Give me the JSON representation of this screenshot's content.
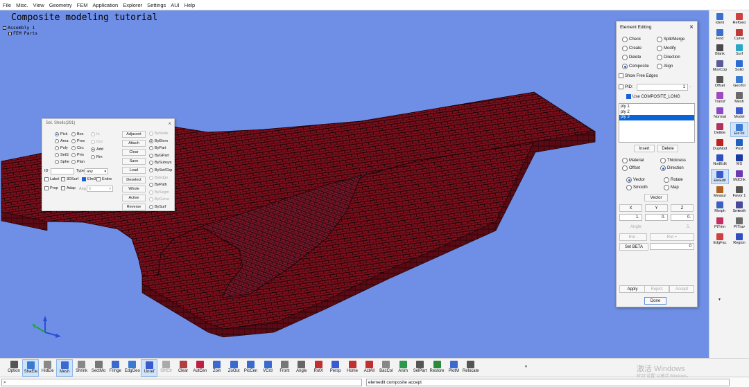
{
  "menu": [
    "File",
    "Misc.",
    "View",
    "Geometry",
    "FEM",
    "Application",
    "Explorer",
    "Settings",
    "AUI",
    "Help"
  ],
  "viewport": {
    "title": "Composite modeling tutorial",
    "tree": [
      "Assembly 1",
      "FEM Parts"
    ],
    "colors": {
      "background": "#6f8fe6",
      "mesh_fill": "#7a0f1c",
      "mesh_line": "#1a0306"
    }
  },
  "sel_shells": {
    "title": "Sel. Shells(291)",
    "close": "×",
    "pick_col1": [
      {
        "label": "Pick",
        "on": true
      },
      {
        "label": "Area",
        "on": false
      },
      {
        "label": "Poly",
        "on": false
      },
      {
        "label": "SetS",
        "on": false
      },
      {
        "label": "Sphe",
        "on": false
      }
    ],
    "pick_col2": [
      {
        "label": "Box",
        "on": false
      },
      {
        "label": "Prox",
        "on": false
      },
      {
        "label": "Circ",
        "on": false
      },
      {
        "label": "Prin",
        "on": false
      },
      {
        "label": "Plan",
        "on": false
      }
    ],
    "mode_col": [
      {
        "label": "In",
        "on": false,
        "dis": true
      },
      {
        "label": "Out",
        "on": false,
        "dis": true
      },
      {
        "label": "Add",
        "on": true,
        "dis": false
      },
      {
        "label": "Rm",
        "on": false,
        "dis": false
      }
    ],
    "buttons": [
      "Adjacent",
      "Attach",
      "Clear",
      "Save",
      "Load",
      "Deselect",
      "Whole",
      "Active",
      "Reverse"
    ],
    "by_options": [
      {
        "label": "ByNode",
        "on": false,
        "dis": true
      },
      {
        "label": "ByElem",
        "on": true,
        "dis": false
      },
      {
        "label": "ByPart",
        "on": false,
        "dis": false
      },
      {
        "label": "ByGPart",
        "on": false,
        "dis": false
      },
      {
        "label": "BySubsys",
        "on": false,
        "dis": false
      },
      {
        "label": "BySet/Grp",
        "on": false,
        "dis": false
      },
      {
        "label": "ByEdge",
        "on": false,
        "dis": true
      },
      {
        "label": "ByPath",
        "on": false,
        "dis": false
      },
      {
        "label": "BySegm",
        "on": false,
        "dis": true
      },
      {
        "label": "ByCurve",
        "on": false,
        "dis": true
      },
      {
        "label": "BySurf",
        "on": false,
        "dis": false
      }
    ],
    "id_label": "ID",
    "type_label": "Type",
    "type_value": "any",
    "checks_row1": [
      {
        "label": "Label",
        "on": false
      },
      {
        "label": "3DSurf",
        "on": false
      },
      {
        "label": "Elm3",
        "on": true
      },
      {
        "label": "Entire",
        "on": false
      }
    ],
    "checks_row2": [
      {
        "label": "Prop",
        "on": false
      },
      {
        "label": "Adap",
        "on": false
      }
    ],
    "ang_label": "Ang",
    "ang_value": "5"
  },
  "elem_edit": {
    "title": "Element Editing",
    "close": "×",
    "ops_left": [
      {
        "label": "Check",
        "on": false
      },
      {
        "label": "Create",
        "on": false
      },
      {
        "label": "Delete",
        "on": false
      },
      {
        "label": "Composite",
        "on": true
      }
    ],
    "ops_right": [
      {
        "label": "Split/Merge",
        "on": false
      },
      {
        "label": "Modify",
        "on": false
      },
      {
        "label": "Direction",
        "on": false
      },
      {
        "label": "Align",
        "on": false
      }
    ],
    "show_free_edges": "Show Free Edges",
    "pid_label": "PID:",
    "pid_value": "1",
    "pid_extra": ".",
    "use_composite_long": "Use COMPOSITE_LONG",
    "plies": [
      {
        "label": "ply 1",
        "sel": false
      },
      {
        "label": "ply 2",
        "sel": false
      },
      {
        "label": "ply 3",
        "sel": true
      }
    ],
    "insert": "Insert",
    "delete": "Delete",
    "props_left": [
      {
        "label": "Material",
        "on": false
      },
      {
        "label": "Offset",
        "on": false
      }
    ],
    "props_right": [
      {
        "label": "Thickness",
        "on": false
      },
      {
        "label": "Direction",
        "on": true
      }
    ],
    "dir_left": [
      {
        "label": "Vector",
        "on": true
      },
      {
        "label": "Smooth",
        "on": false
      }
    ],
    "dir_right": [
      {
        "label": "Rotate",
        "on": false
      },
      {
        "label": "Map",
        "on": false
      }
    ],
    "vector_btn": "Vector",
    "axes": [
      "X",
      "Y",
      "Z"
    ],
    "vec_values": [
      "1.",
      "0.",
      "0."
    ],
    "angle_label": "Angle:",
    "angle_value": "5.",
    "rot_minus": "Rot -",
    "rot_plus": "Rot +",
    "set_beta": "Set BETA",
    "beta_value": "0",
    "apply": "Apply",
    "reject": "Reject",
    "accept": "Accept",
    "done": "Done"
  },
  "right_toolbar": [
    {
      "label": "Ident",
      "icon": "ident-icon",
      "color": "#3b6fcf"
    },
    {
      "label": "RefGeo",
      "icon": "refgeo-icon",
      "color": "#d04040"
    },
    {
      "label": "Find",
      "icon": "find-icon",
      "color": "#3b6fcf"
    },
    {
      "label": "Curve",
      "icon": "curve-icon",
      "color": "#c03a3a"
    },
    {
      "label": "Blank",
      "icon": "blank-icon",
      "color": "#4a4a4a"
    },
    {
      "label": "Surf",
      "icon": "surf-icon",
      "color": "#2aa7c6"
    },
    {
      "label": "MovCop",
      "icon": "movcop-icon",
      "color": "#5a5a9a"
    },
    {
      "label": "Solid",
      "icon": "solid-icon",
      "color": "#2b6bd6"
    },
    {
      "label": "Offset",
      "icon": "offset-icon",
      "color": "#555"
    },
    {
      "label": "GeoTol",
      "icon": "geotol-icon",
      "color": "#3a7ad0"
    },
    {
      "label": "Transf",
      "icon": "transf-icon",
      "color": "#a04ac0"
    },
    {
      "label": "Mesh",
      "icon": "mesh-icon",
      "color": "#6a6a6a"
    },
    {
      "label": "Normal",
      "icon": "normal-icon",
      "color": "#8a4ac8"
    },
    {
      "label": "Model",
      "icon": "model-icon",
      "color": "#3a5ad0"
    },
    {
      "label": "DetEle",
      "icon": "detele-icon",
      "color": "#b03060"
    },
    {
      "label": "EleTol",
      "icon": "eletol-icon",
      "color": "#3a7ad0"
    },
    {
      "label": "DupNod",
      "icon": "dupnod-icon",
      "color": "#c02020"
    },
    {
      "label": "Post",
      "icon": "post-icon",
      "color": "#2060c0"
    },
    {
      "label": "NodEdit",
      "icon": "nodedit-icon",
      "color": "#3050c0"
    },
    {
      "label": "MS",
      "icon": "ms-icon",
      "color": "#1a3aa0"
    },
    {
      "label": "EleEdit",
      "icon": "eleedit-icon",
      "color": "#3a5ad0"
    },
    {
      "label": "MdChk",
      "icon": "mdchk-icon",
      "color": "#6a3ab0"
    },
    {
      "label": "Measur",
      "icon": "measur-icon",
      "color": "#b06020"
    },
    {
      "label": "Favor 1",
      "icon": "favor-icon",
      "color": "#555"
    },
    {
      "label": "Morph",
      "icon": "morph-icon",
      "color": "#4060c0"
    },
    {
      "label": "Smooth",
      "icon": "smooth-icon",
      "color": "#4a4a9a"
    },
    {
      "label": "PtTrim",
      "icon": "pttrim-icon",
      "color": "#c03060"
    },
    {
      "label": "PtTrav",
      "icon": "pttrav-icon",
      "color": "#6a6a6a"
    },
    {
      "label": "EdgFac",
      "icon": "edgfac-icon",
      "color": "#d04040"
    },
    {
      "label": "Region",
      "icon": "region-icon",
      "color": "#3050c0"
    }
  ],
  "bottom_toolbar": [
    {
      "label": "Option",
      "icon": "option-icon",
      "color": "#555"
    },
    {
      "label": "ShaEle",
      "icon": "shaele-icon",
      "color": "#3a7ad0"
    },
    {
      "label": "HidEle",
      "icon": "hidele-icon",
      "color": "#888"
    },
    {
      "label": "Mesh",
      "icon": "mesh-icon",
      "color": "#3a6ad0"
    },
    {
      "label": "Shrink",
      "icon": "shrink-icon",
      "color": "#888"
    },
    {
      "label": "SectMo",
      "icon": "sectmo-icon",
      "color": "#777"
    },
    {
      "label": "Fringe",
      "icon": "fringe-icon",
      "color": "#3a6ad0"
    },
    {
      "label": "EdgGeo",
      "icon": "edggeo-icon",
      "color": "#3a7ad0"
    },
    {
      "label": "Unref",
      "icon": "unref-icon",
      "color": "#3a5ad0"
    },
    {
      "label": "ShfCtr",
      "icon": "shfctr-icon",
      "color": "#aaa"
    },
    {
      "label": "Clear",
      "icon": "clear-icon",
      "color": "#b04040"
    },
    {
      "label": "AutCen",
      "icon": "autcen-icon",
      "color": "#c02040"
    },
    {
      "label": "Zoin",
      "icon": "zoin-icon",
      "color": "#3a6ad0"
    },
    {
      "label": "ZoOut",
      "icon": "zoout-icon",
      "color": "#3a6ad0"
    },
    {
      "label": "PicCen",
      "icon": "piccen-icon",
      "color": "#3a6ad0"
    },
    {
      "label": "VCrd",
      "icon": "vcrd-icon",
      "color": "#3a6ad0"
    },
    {
      "label": "Front",
      "icon": "front-icon",
      "color": "#777"
    },
    {
      "label": "Angle",
      "icon": "angle-icon",
      "color": "#666"
    },
    {
      "label": "RotX",
      "icon": "rotx-icon",
      "color": "#c03030"
    },
    {
      "label": "Persp",
      "icon": "persp-icon",
      "color": "#3a5ad0"
    },
    {
      "label": "Home",
      "icon": "home-icon",
      "color": "#c03030"
    },
    {
      "label": "ActAll",
      "icon": "actall-icon",
      "color": "#c03030"
    },
    {
      "label": "BacCol",
      "icon": "baccol-icon",
      "color": "#888"
    },
    {
      "label": "Anim",
      "icon": "anim-icon",
      "color": "#2a9a4a"
    },
    {
      "label": "SelPart",
      "icon": "selpart-icon",
      "color": "#555"
    },
    {
      "label": "Restore",
      "icon": "restore-icon",
      "color": "#2a8a3a"
    },
    {
      "label": "PlotM",
      "icon": "plotm-icon",
      "color": "#3a6ad0"
    },
    {
      "label": "Relocate",
      "icon": "relocate-icon",
      "color": "#555"
    }
  ],
  "bottom_extra": {
    "shift_label": "Shift Cen",
    "angle_value": "-10"
  },
  "command": {
    "prompt": ">",
    "status": "elemedit composite accept"
  },
  "watermark": {
    "line1": "激活 Windows",
    "line2": "转到\"设置\"以激活 Windows。"
  }
}
